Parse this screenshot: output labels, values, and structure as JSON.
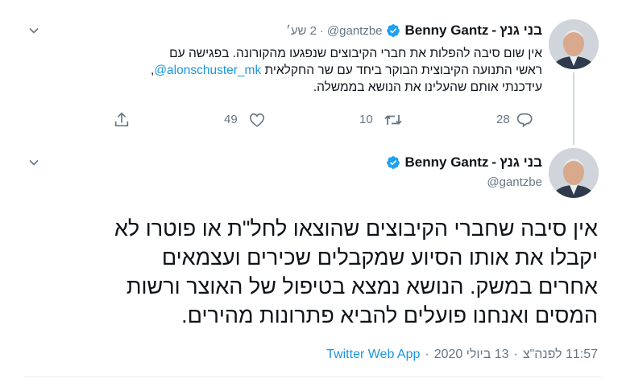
{
  "tweet1": {
    "display_name_he": "בני גנץ",
    "display_name_sep": "-",
    "display_name_en": "Benny Gantz",
    "handle": "@gantzbe",
    "dot": "·",
    "time": "2 שע׳",
    "text_line1": "אין שום סיבה להפלות את חברי הקיבוצים שנפגעו מהקורונה. בפגישה עם",
    "text_line2_prefix": "ראשי התנועה הקיבוצית הבוקר ביחד עם שר החקלאית ",
    "mention": "@alonschuster_mk",
    "text_line2_suffix": ",",
    "text_line3": "עידכנתי אותם שהעלינו את הנושא בממשלה.",
    "reply_count": "28",
    "retweet_count": "10",
    "like_count": "49"
  },
  "tweet2": {
    "display_name_he": "בני גנץ",
    "display_name_sep": "-",
    "display_name_en": "Benny Gantz",
    "handle": "@gantzbe",
    "text_line1": "אין סיבה שחברי הקיבוצים שהוצאו לחל\"ת או פוטרו לא",
    "text_line2": "יקבלו את אותו הסיוע שמקבלים שכירים ועצמאים",
    "text_line3": "אחרים במשק. הנושא נמצא בטיפול של האוצר ורשות",
    "text_line4": "המסים ואנחנו פועלים להביא פתרונות מהירים.",
    "meta_time": "11:57 לפנה\"צ",
    "meta_dot1": "·",
    "meta_date": "13 ביולי 2020",
    "meta_dot2": "·",
    "meta_source": "Twitter Web App"
  },
  "colors": {
    "link": "#1b95e0",
    "verified": "#1da1f2",
    "muted": "#657786",
    "divider": "#e6ecf0"
  },
  "icons": [
    "chevron-down-icon",
    "verified-badge-icon",
    "reply-icon",
    "retweet-icon",
    "like-icon",
    "share-icon",
    "avatar"
  ]
}
